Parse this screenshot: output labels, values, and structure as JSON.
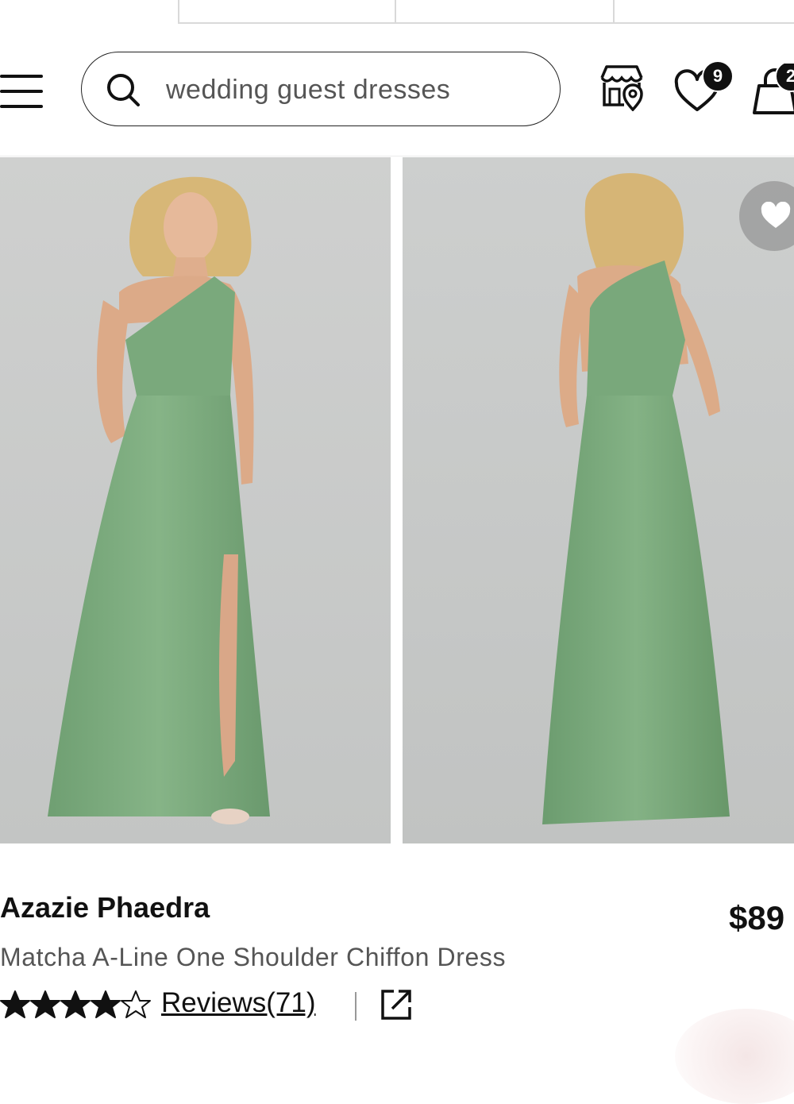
{
  "search": {
    "placeholder": "wedding guest dresses"
  },
  "header": {
    "wishlist_count": "9",
    "cart_count": "2"
  },
  "product": {
    "brand": "Azazie Phaedra",
    "price": "$89",
    "description": "Matcha A-Line One Shoulder Chiffon Dress",
    "rating": 4,
    "rating_max": 5,
    "reviews_label": "Reviews(71)"
  },
  "colors": {
    "dress": "#7fae80",
    "backdrop": "#c8c9c9",
    "accent": "#111111"
  },
  "icons": {
    "menu": "hamburger-icon",
    "search": "search-icon",
    "store": "store-location-icon",
    "wishlist": "heart-icon",
    "cart": "shopping-bag-icon",
    "favorite": "heart-icon",
    "external": "external-link-icon"
  }
}
